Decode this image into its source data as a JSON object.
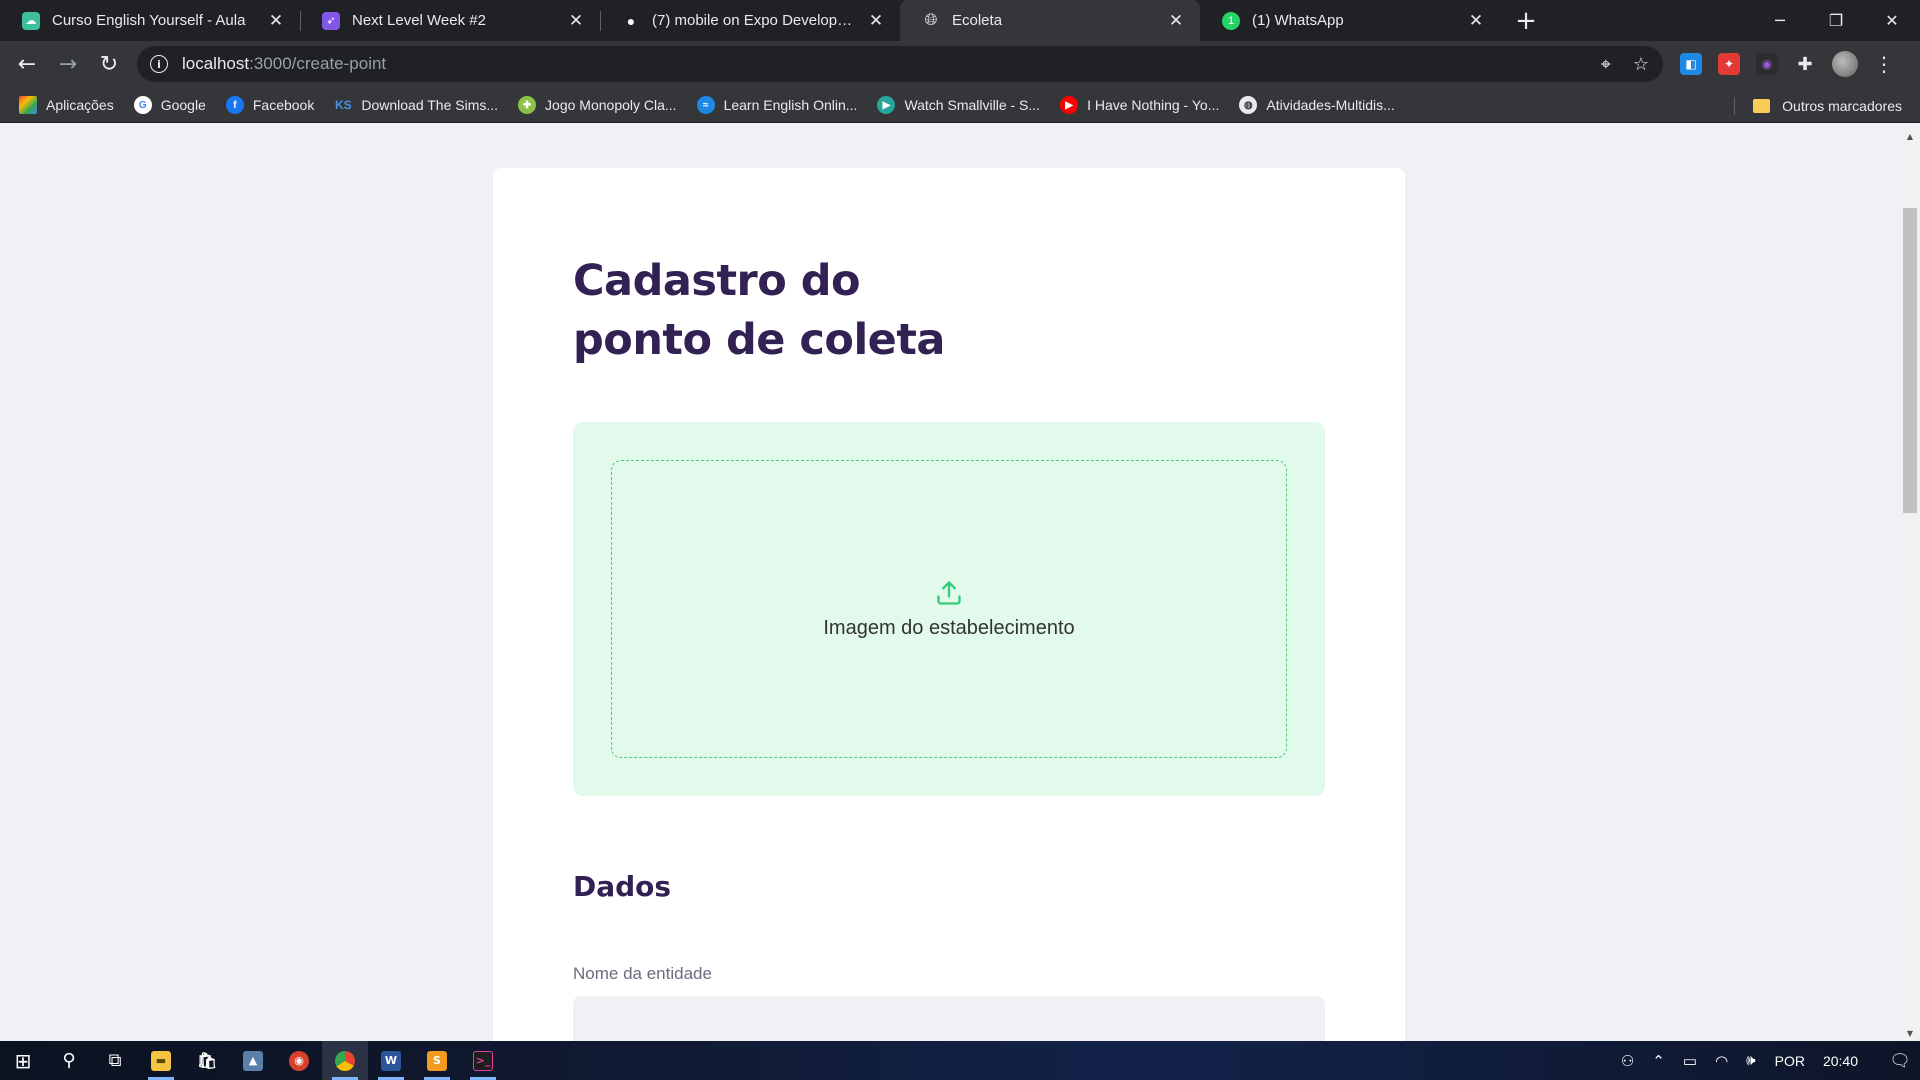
{
  "browser": {
    "tabs": [
      {
        "title": "Curso English Yourself - Aula",
        "icon": "cloud-favicon-icon",
        "color": "#3dbf9f",
        "active": false
      },
      {
        "title": "Next Level Week #2",
        "icon": "rocket-favicon-icon",
        "color": "#8257e5",
        "active": false
      },
      {
        "title": "(7) mobile on Expo Developer Tools",
        "icon": "expo-favicon-icon",
        "color": "#ffffff",
        "active": false
      },
      {
        "title": "Ecoleta",
        "icon": "globe-favicon-icon",
        "color": "#e8eaed",
        "active": true
      },
      {
        "title": "(1) WhatsApp",
        "icon": "whatsapp-favicon-icon",
        "color": "#25d366",
        "active": false
      }
    ],
    "url_host": "localhost",
    "url_path": ":3000/create-point",
    "bookmarks": [
      {
        "label": "Aplicações",
        "icon": "apps-grid-icon",
        "color": "#ea4335"
      },
      {
        "label": "Google",
        "icon": "google-icon",
        "color": "#4285f4"
      },
      {
        "label": "Facebook",
        "icon": "facebook-icon",
        "color": "#1877f2"
      },
      {
        "label": "Download The Sims...",
        "icon": "ks-icon",
        "color": "#2b6cc4"
      },
      {
        "label": "Jogo Monopoly Cla...",
        "icon": "game-icon",
        "color": "#8bc34a"
      },
      {
        "label": "Learn English Onlin...",
        "icon": "wave-icon",
        "color": "#1e88e5"
      },
      {
        "label": "Watch Smallville - S...",
        "icon": "play-icon",
        "color": "#26a69a"
      },
      {
        "label": "I Have Nothing - Yo...",
        "icon": "youtube-icon",
        "color": "#ff0000"
      },
      {
        "label": "Atividades-Multidis...",
        "icon": "globe-icon",
        "color": "#e8eaed"
      }
    ],
    "other_bookmarks": "Outros marcadores"
  },
  "page": {
    "heading_line1": "Cadastro do",
    "heading_line2": "ponto de coleta",
    "dropzone_label": "Imagem do estabelecimento",
    "section_title": "Dados",
    "entity_label": "Nome da entidade",
    "entity_value": "",
    "accent_color": "#34cb79",
    "title_color": "#322153",
    "background_color": "#f0f0f5"
  },
  "taskbar": {
    "language": "POR",
    "time": "20:40"
  }
}
